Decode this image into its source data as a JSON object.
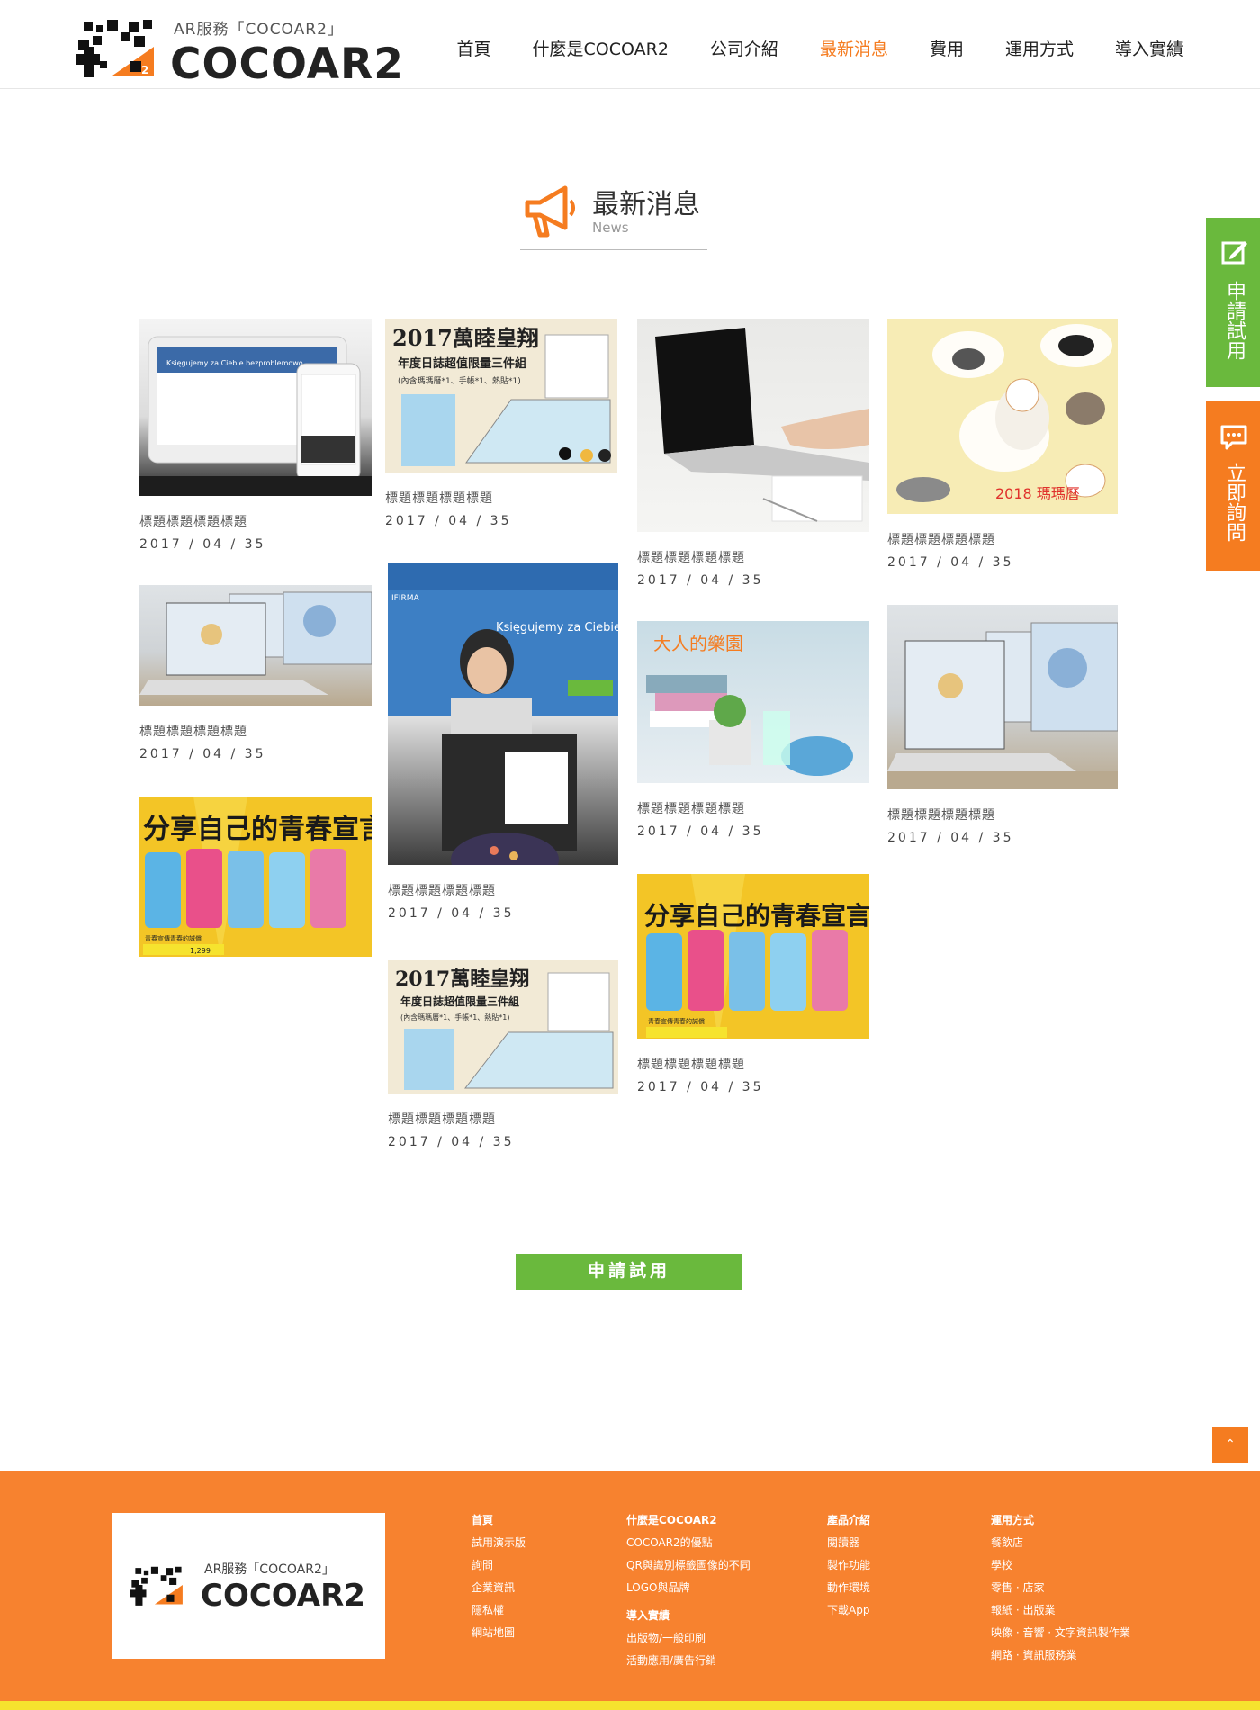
{
  "header": {
    "logo_sub": "AR服務「COCOAR2」",
    "logo_main": "COCOAR2",
    "nav": [
      "首頁",
      "什麼是COCOAR2",
      "公司介紹",
      "最新消息",
      "費用",
      "運用方式",
      "導入實績"
    ],
    "active_nav": "最新消息"
  },
  "section": {
    "title_zh": "最新消息",
    "title_en": "News",
    "icon": "megaphone-icon"
  },
  "cards": [
    {
      "title": "標題標題標題標題",
      "date": "2017 / 04 / 35",
      "image": "tablet-phone"
    },
    {
      "title": "標題標題標題標題",
      "date": "2017 / 04 / 35",
      "image": "calendar-2017"
    },
    {
      "title": "標題標題標題標題",
      "date": "2017 / 04 / 35",
      "image": "laptop-typing"
    },
    {
      "title": "標題標題標題標題",
      "date": "2017 / 04 / 35",
      "image": "cats-calendar"
    },
    {
      "title": "標題標題標題標題",
      "date": "2017 / 04 / 35",
      "image": "macbook-screens"
    },
    {
      "title": "標題標題標題標題",
      "date": "2017 / 04 / 35",
      "image": "woman-laptop"
    },
    {
      "title": "標題標題標題標題",
      "date": "2017 / 04 / 35",
      "image": "desk-plants"
    },
    {
      "title": "標題標題標題標題",
      "date": "2017 / 04 / 35",
      "image": "macbook-screens"
    },
    {
      "title": "",
      "date": "",
      "image": "share-youth"
    },
    {
      "title": "標題標題標題標題",
      "date": "2017 / 04 / 35",
      "image": "calendar-2017"
    },
    {
      "title": "標題標題標題標題",
      "date": "2017 / 04 / 35",
      "image": "share-youth"
    }
  ],
  "image_text": {
    "tablet": "Księgujemy za Ciebie bezproblemowo",
    "calendar_year": "2017萬睦皇翔",
    "calendar_sub": "年度日誌超值限量三件組",
    "calendar_note": "(內含瑪瑪曆*1、手帳*1、熱貼*1)",
    "cats": "2018 瑪瑪曆",
    "woman": "Księgujemy za Ciebie bezproblemowo",
    "woman_brand": "IFIRMA",
    "desk": "大人的樂園",
    "share": "分享自己的青春宣言",
    "share_note": "青春宣傳青春的誠償",
    "share_price": "1,299"
  },
  "cta": "申請試用",
  "side": {
    "apply": "申請試用",
    "ask": "立即詢問"
  },
  "totop": "⌃",
  "footer": {
    "logo_sub": "AR服務「COCOAR2」",
    "logo_main": "COCOAR2",
    "col1": {
      "items": [
        "首頁",
        "試用演示版",
        "詢問",
        "企業資訊",
        "隱私權",
        "網站地圖"
      ]
    },
    "col2": {
      "head": "什麼是COCOAR2",
      "items": [
        "COCOAR2的優點",
        "QR與識別標籤圖像的不同",
        "LOGO與品牌"
      ],
      "head2": "導入實績",
      "items2": [
        "出版物/一般印刷",
        "活動應用/廣告行銷"
      ]
    },
    "col3": {
      "head": "產品介紹",
      "items": [
        "閱讀器",
        "製作功能",
        "動作環境",
        "下載App"
      ]
    },
    "col4": {
      "head": "運用方式",
      "items": [
        "餐飲店",
        "學校",
        "零售 · 店家",
        "報紙 · 出版業",
        "映像 · 音響 · 文字資訊製作業",
        "網路 · 資訊服務業"
      ]
    }
  },
  "colors": {
    "accent_orange": "#f57c20",
    "accent_green": "#6ab93d",
    "footer_orange": "#f7822f"
  }
}
